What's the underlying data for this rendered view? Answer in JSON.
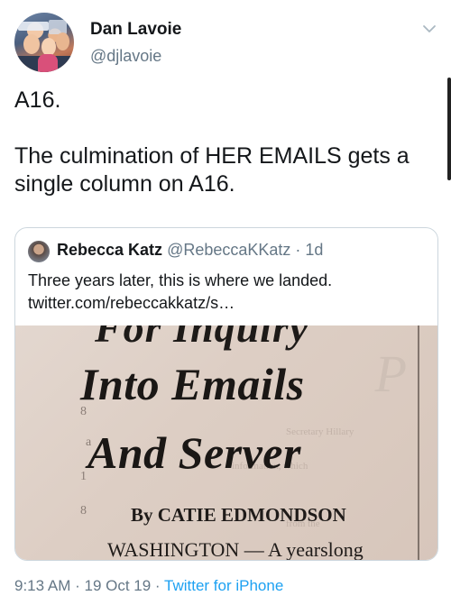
{
  "author": {
    "name": "Dan Lavoie",
    "handle": "@djlavoie"
  },
  "tweet": {
    "text": "A16.\n\nThe culmination of HER EMAILS gets a single column on A16."
  },
  "quoted_tweet": {
    "author_name": "Rebecca Katz",
    "author_handle": "@RebeccaKKatz",
    "separator": " · ",
    "age": "1d",
    "text": "Three years later, this is where we landed. twitter.com/rebeccakkatz/s…",
    "image": {
      "headline_cut": "For Inquiry",
      "headline_line1": "Into Emails",
      "headline_line2": "And Server",
      "byline": "By CATIE EDMONDSON",
      "dateline": "WASHINGTON — A yearslong"
    }
  },
  "meta": {
    "time": "9:13 AM",
    "dot": " · ",
    "date": "19 Oct 19",
    "source": "Twitter for iPhone"
  },
  "icons": {
    "menu": "chevron-down-icon"
  }
}
